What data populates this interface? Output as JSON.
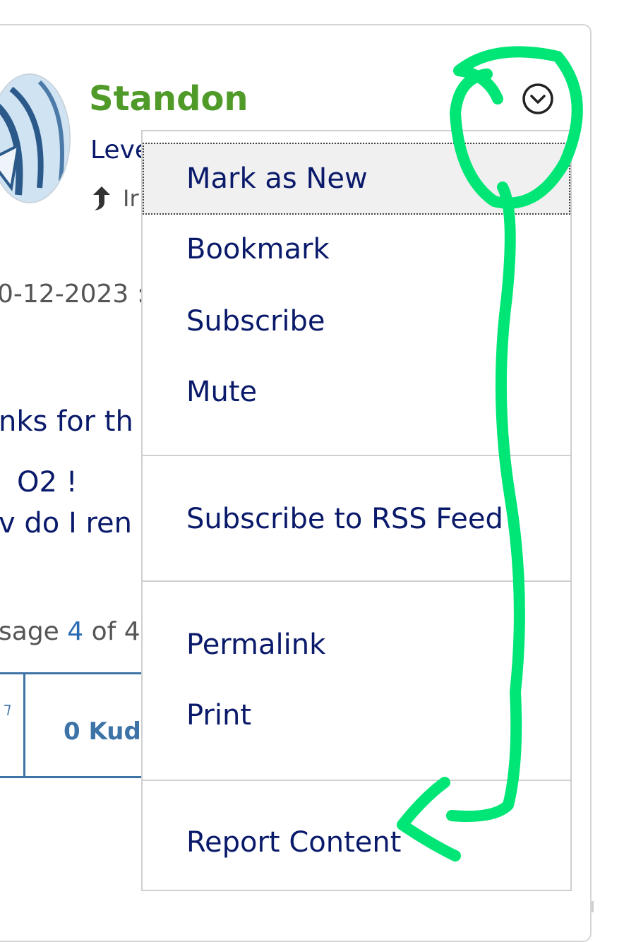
{
  "post": {
    "author": "Standon",
    "rank": "Leve",
    "reply_text": "Ir",
    "date": "0-12-2023 :",
    "body_lines": [
      "nks for th",
      "O2 !",
      "v do I ren"
    ],
    "message_prefix": "sage",
    "message_number": "4",
    "message_suffix": "of 4",
    "kudos_label": "0 Kud"
  },
  "menu": {
    "groups": [
      [
        "Mark as New",
        "Bookmark",
        "Subscribe",
        "Mute"
      ],
      [
        "Subscribe to RSS Feed"
      ],
      [
        "Permalink",
        "Print"
      ],
      [
        "Report Content"
      ]
    ],
    "focused_item": "Mark as New"
  },
  "icons": {
    "options": "chevron-down-circle-icon",
    "reply": "reply-arrow-icon"
  },
  "colors": {
    "author": "#4f9a28",
    "link_text": "#0a1a6a",
    "accent_blue": "#3e73a8",
    "annotation": "#00e676"
  }
}
